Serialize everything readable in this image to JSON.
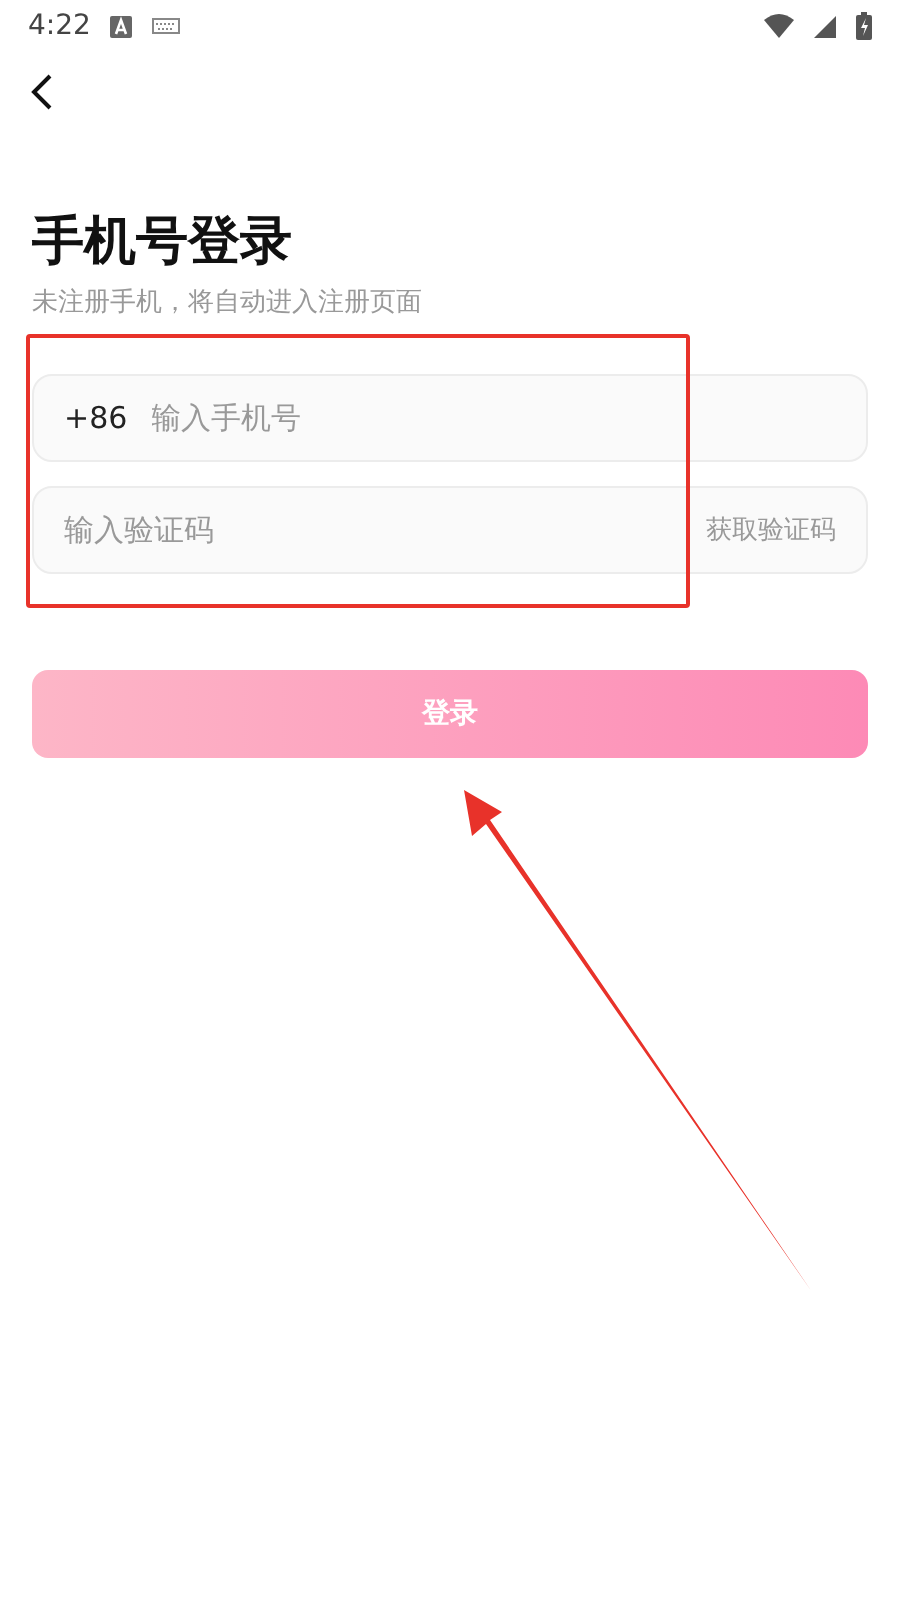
{
  "status_bar": {
    "time": "4:22"
  },
  "title": "手机号登录",
  "subtitle": "未注册手机，将自动进入注册页面",
  "phone_field": {
    "prefix": "+86",
    "placeholder": "输入手机号"
  },
  "code_field": {
    "placeholder": "输入验证码",
    "action": "获取验证码"
  },
  "login_button": {
    "label": "登录"
  }
}
